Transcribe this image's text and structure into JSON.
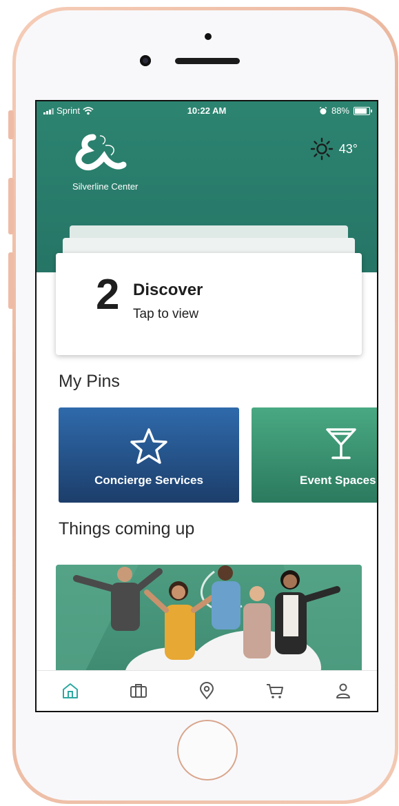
{
  "status_bar": {
    "carrier": "Sprint",
    "time": "10:22 AM",
    "battery": "88%"
  },
  "header": {
    "brand_name": "Silverline Center",
    "temperature": "43°",
    "weather_icon": "sun-icon",
    "background_color": "#2c8470"
  },
  "discover_card": {
    "count": "2",
    "title": "Discover",
    "subtitle": "Tap to view"
  },
  "my_pins": {
    "title": "My Pins",
    "items": [
      {
        "label": "Concierge Services",
        "icon": "star-icon",
        "color": "#2f6aab"
      },
      {
        "label": "Event Spaces",
        "icon": "cocktail-glass-icon",
        "color": "#49a982"
      }
    ]
  },
  "upcoming": {
    "title": "Things coming up"
  },
  "tab_bar": {
    "active_color": "#2aa8a0",
    "items": [
      {
        "icon": "home-icon",
        "active": true
      },
      {
        "icon": "briefcase-icon",
        "active": false
      },
      {
        "icon": "location-pin-icon",
        "active": false
      },
      {
        "icon": "cart-icon",
        "active": false
      },
      {
        "icon": "profile-icon",
        "active": false
      }
    ]
  }
}
